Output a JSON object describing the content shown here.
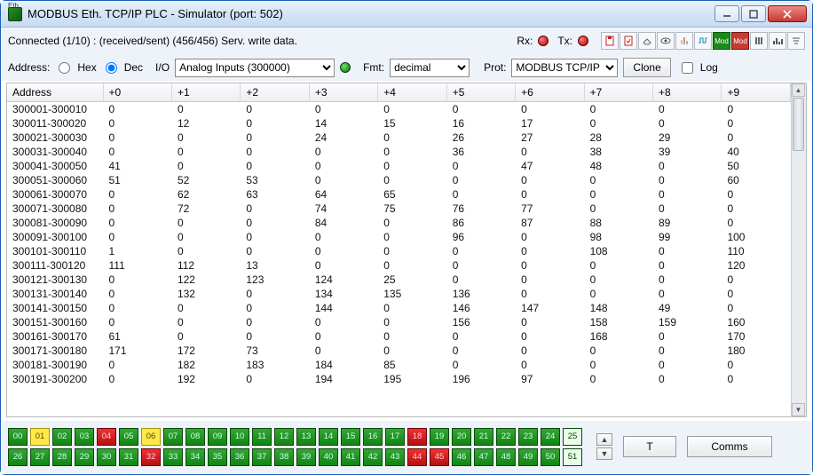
{
  "window": {
    "title": "MODBUS Eth. TCP/IP PLC - Simulator (port: 502)"
  },
  "status": {
    "text": "Connected (1/10) : (received/sent) (456/456) Serv. write data.",
    "rx_label": "Rx:",
    "tx_label": "Tx:"
  },
  "toolbar_icons": [
    "save-icon",
    "open-icon",
    "erase-icon",
    "settings-icon",
    "noise-icon",
    "pulse-icon",
    "mod-run-icon",
    "mod-stop-icon",
    "columns-icon",
    "bars-icon",
    "filter-icon"
  ],
  "options": {
    "address_label": "Address:",
    "hex_label": "Hex",
    "dec_label": "Dec",
    "address_mode": "Dec",
    "io_label": "I/O",
    "io_selected": "Analog Inputs (300000)",
    "fmt_label": "Fmt:",
    "fmt_selected": "decimal",
    "prot_label": "Prot:",
    "prot_selected": "MODBUS TCP/IP",
    "clone_label": "Clone",
    "log_label": "Log"
  },
  "grid": {
    "headers": [
      "Address",
      "+0",
      "+1",
      "+2",
      "+3",
      "+4",
      "+5",
      "+6",
      "+7",
      "+8",
      "+9"
    ],
    "rows": [
      {
        "addr": "300001-300010",
        "v": [
          "0",
          "0",
          "0",
          "0",
          "0",
          "0",
          "0",
          "0",
          "0",
          "0"
        ]
      },
      {
        "addr": "300011-300020",
        "v": [
          "0",
          "12",
          "0",
          "14",
          "15",
          "16",
          "17",
          "0",
          "0",
          "0"
        ]
      },
      {
        "addr": "300021-300030",
        "v": [
          "0",
          "0",
          "0",
          "24",
          "0",
          "26",
          "27",
          "28",
          "29",
          "0"
        ]
      },
      {
        "addr": "300031-300040",
        "v": [
          "0",
          "0",
          "0",
          "0",
          "0",
          "36",
          "0",
          "38",
          "39",
          "40"
        ]
      },
      {
        "addr": "300041-300050",
        "v": [
          "41",
          "0",
          "0",
          "0",
          "0",
          "0",
          "47",
          "48",
          "0",
          "50"
        ]
      },
      {
        "addr": "300051-300060",
        "v": [
          "51",
          "52",
          "53",
          "0",
          "0",
          "0",
          "0",
          "0",
          "0",
          "60"
        ]
      },
      {
        "addr": "300061-300070",
        "v": [
          "0",
          "62",
          "63",
          "64",
          "65",
          "0",
          "0",
          "0",
          "0",
          "0"
        ]
      },
      {
        "addr": "300071-300080",
        "v": [
          "0",
          "72",
          "0",
          "74",
          "75",
          "76",
          "77",
          "0",
          "0",
          "0"
        ]
      },
      {
        "addr": "300081-300090",
        "v": [
          "0",
          "0",
          "0",
          "84",
          "0",
          "86",
          "87",
          "88",
          "89",
          "0"
        ]
      },
      {
        "addr": "300091-300100",
        "v": [
          "0",
          "0",
          "0",
          "0",
          "0",
          "96",
          "0",
          "98",
          "99",
          "100"
        ]
      },
      {
        "addr": "300101-300110",
        "v": [
          "1",
          "0",
          "0",
          "0",
          "0",
          "0",
          "0",
          "108",
          "0",
          "110"
        ]
      },
      {
        "addr": "300111-300120",
        "v": [
          "111",
          "112",
          "13",
          "0",
          "0",
          "0",
          "0",
          "0",
          "0",
          "120"
        ]
      },
      {
        "addr": "300121-300130",
        "v": [
          "0",
          "122",
          "123",
          "124",
          "25",
          "0",
          "0",
          "0",
          "0",
          "0"
        ]
      },
      {
        "addr": "300131-300140",
        "v": [
          "0",
          "132",
          "0",
          "134",
          "135",
          "136",
          "0",
          "0",
          "0",
          "0"
        ]
      },
      {
        "addr": "300141-300150",
        "v": [
          "0",
          "0",
          "0",
          "144",
          "0",
          "146",
          "147",
          "148",
          "49",
          "0"
        ]
      },
      {
        "addr": "300151-300160",
        "v": [
          "0",
          "0",
          "0",
          "0",
          "0",
          "156",
          "0",
          "158",
          "159",
          "160"
        ]
      },
      {
        "addr": "300161-300170",
        "v": [
          "61",
          "0",
          "0",
          "0",
          "0",
          "0",
          "0",
          "168",
          "0",
          "170"
        ]
      },
      {
        "addr": "300171-300180",
        "v": [
          "171",
          "172",
          "73",
          "0",
          "0",
          "0",
          "0",
          "0",
          "0",
          "180"
        ]
      },
      {
        "addr": "300181-300190",
        "v": [
          "0",
          "182",
          "183",
          "184",
          "85",
          "0",
          "0",
          "0",
          "0",
          "0"
        ]
      },
      {
        "addr": "300191-300200",
        "v": [
          "0",
          "192",
          "0",
          "194",
          "195",
          "196",
          "97",
          "0",
          "0",
          "0"
        ]
      }
    ]
  },
  "bottom": {
    "t_button": "T",
    "comms_button": "Comms",
    "cells_row1": [
      {
        "n": "00",
        "c": "g"
      },
      {
        "n": "01",
        "c": "y"
      },
      {
        "n": "02",
        "c": "g"
      },
      {
        "n": "03",
        "c": "g"
      },
      {
        "n": "04",
        "c": "r"
      },
      {
        "n": "05",
        "c": "g"
      },
      {
        "n": "06",
        "c": "y"
      },
      {
        "n": "07",
        "c": "g"
      },
      {
        "n": "08",
        "c": "g"
      },
      {
        "n": "09",
        "c": "g"
      },
      {
        "n": "10",
        "c": "g"
      },
      {
        "n": "11",
        "c": "g"
      },
      {
        "n": "12",
        "c": "g"
      },
      {
        "n": "13",
        "c": "g"
      },
      {
        "n": "14",
        "c": "g"
      },
      {
        "n": "15",
        "c": "g"
      },
      {
        "n": "16",
        "c": "g"
      },
      {
        "n": "17",
        "c": "g"
      },
      {
        "n": "18",
        "c": "r"
      },
      {
        "n": "19",
        "c": "g"
      },
      {
        "n": "20",
        "c": "g"
      },
      {
        "n": "21",
        "c": "g"
      },
      {
        "n": "22",
        "c": "g"
      },
      {
        "n": "23",
        "c": "g"
      },
      {
        "n": "24",
        "c": "g"
      },
      {
        "n": "25",
        "c": "p"
      }
    ],
    "cells_row2": [
      {
        "n": "26",
        "c": "g"
      },
      {
        "n": "27",
        "c": "g"
      },
      {
        "n": "28",
        "c": "g"
      },
      {
        "n": "29",
        "c": "g"
      },
      {
        "n": "30",
        "c": "g"
      },
      {
        "n": "31",
        "c": "g"
      },
      {
        "n": "32",
        "c": "r"
      },
      {
        "n": "33",
        "c": "g"
      },
      {
        "n": "34",
        "c": "g"
      },
      {
        "n": "35",
        "c": "g"
      },
      {
        "n": "36",
        "c": "g"
      },
      {
        "n": "37",
        "c": "g"
      },
      {
        "n": "38",
        "c": "g"
      },
      {
        "n": "39",
        "c": "g"
      },
      {
        "n": "40",
        "c": "g"
      },
      {
        "n": "41",
        "c": "g"
      },
      {
        "n": "42",
        "c": "g"
      },
      {
        "n": "43",
        "c": "g"
      },
      {
        "n": "44",
        "c": "r"
      },
      {
        "n": "45",
        "c": "r"
      },
      {
        "n": "46",
        "c": "g"
      },
      {
        "n": "47",
        "c": "g"
      },
      {
        "n": "48",
        "c": "g"
      },
      {
        "n": "49",
        "c": "g"
      },
      {
        "n": "50",
        "c": "g"
      },
      {
        "n": "51",
        "c": "p"
      }
    ]
  }
}
